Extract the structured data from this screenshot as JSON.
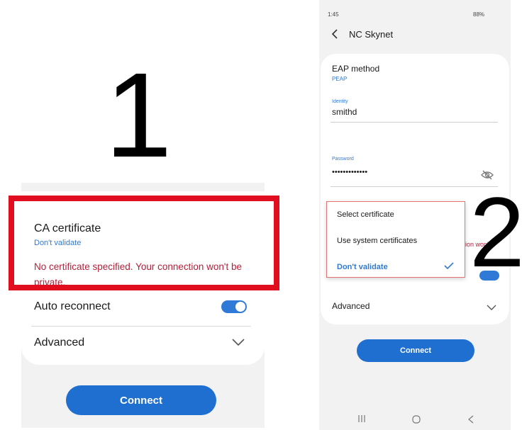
{
  "step_one": {
    "number": "1",
    "ca_certificate": {
      "title": "CA certificate",
      "value": "Don't validate",
      "warning": "No certificate specified. Your connection won't be private."
    },
    "auto_reconnect": {
      "label": "Auto reconnect",
      "enabled": true
    },
    "advanced": {
      "label": "Advanced"
    },
    "connect_label": "Connect",
    "highlight_color": "#e10e1f"
  },
  "step_two": {
    "number": "2",
    "status_bar": {
      "time": "1:45",
      "battery": "88%"
    },
    "header": {
      "title": "NC Skynet"
    },
    "eap_method": {
      "label": "EAP method",
      "value": "PEAP"
    },
    "identity": {
      "label": "Identity",
      "value": "smithd"
    },
    "password": {
      "label": "Password",
      "value": "•••••••••••••"
    },
    "peek_text": "ion won't",
    "dropdown": {
      "options": [
        "Select certificate",
        "Use system certificates",
        "Don't validate"
      ],
      "selected": "Don't validate"
    },
    "advanced": {
      "label": "Advanced"
    },
    "connect_label": "Connect"
  },
  "colors": {
    "accent": "#2f7ad6",
    "button": "#1f6fd0",
    "warning": "#b3203a"
  }
}
